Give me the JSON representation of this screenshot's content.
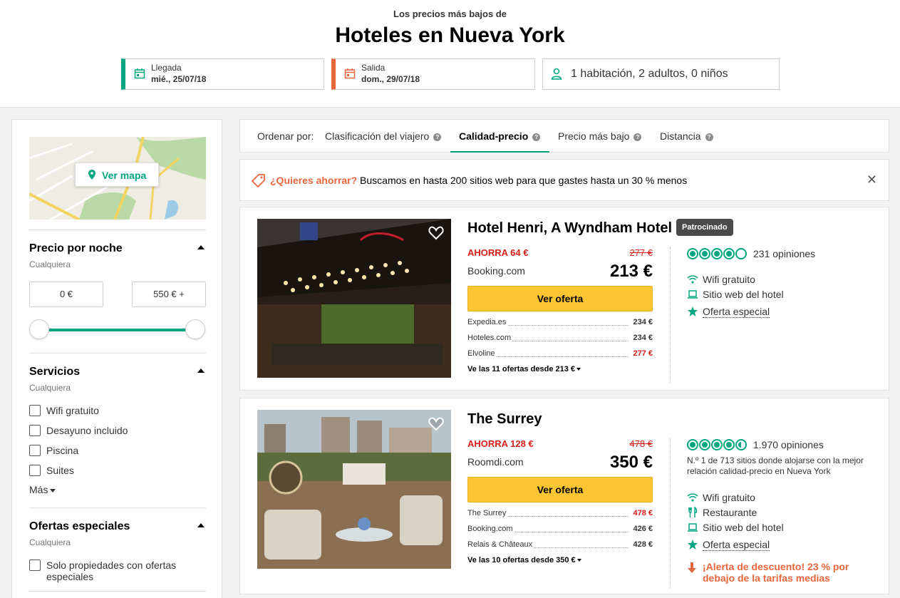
{
  "header": {
    "subtitle": "Los precios más bajos de",
    "title": "Hoteles en Nueva York",
    "checkin": {
      "label": "Llegada",
      "value": "mié., 25/07/18"
    },
    "checkout": {
      "label": "Salida",
      "value": "dom., 29/07/18"
    },
    "guests": "1 habitación, 2 adultos, 0 niños"
  },
  "sidebar": {
    "map_button": "Ver mapa",
    "price": {
      "title": "Precio por noche",
      "subtitle": "Cualquiera",
      "min": "0 €",
      "max": "550 € +",
      "range_selected": [
        0,
        1
      ]
    },
    "services": {
      "title": "Servicios",
      "subtitle": "Cualquiera",
      "items": [
        "Wifi gratuito",
        "Desayuno incluido",
        "Piscina",
        "Suites"
      ],
      "more": "Más"
    },
    "offers": {
      "title": "Ofertas especiales",
      "subtitle": "Cualquiera",
      "items": [
        "Solo propiedades con ofertas especiales"
      ]
    }
  },
  "sort": {
    "label": "Ordenar por:",
    "options": [
      "Clasificación del viajero",
      "Calidad-precio",
      "Precio más bajo",
      "Distancia"
    ],
    "active": "Calidad-precio"
  },
  "savings_banner": {
    "highlight": "¿Quieres ahorrar?",
    "text": "Buscamos en hasta 200 sitios web para que gastes hasta un 30 % menos"
  },
  "hotels": [
    {
      "name": "Hotel Henri, A Wyndham Hotel",
      "badge": "Patrocinado",
      "saving": "AHORRA 64 €",
      "original_price": "277 €",
      "provider": "Booking.com",
      "price": "213 €",
      "button": "Ver oferta",
      "offers": [
        {
          "name": "Expedia.es",
          "price": "234 €",
          "red": false
        },
        {
          "name": "Hoteles.com",
          "price": "234 €",
          "red": false
        },
        {
          "name": "Elvoline",
          "price": "277 €",
          "red": true
        }
      ],
      "see_all": "Ve las 11 ofertas desde 213 €",
      "rating": 4,
      "reviews": "231 opiniones",
      "amenities": [
        "Wifi gratuito",
        "Sitio web del hotel",
        "Oferta especial"
      ]
    },
    {
      "name": "The Surrey",
      "saving": "AHORRA 128 €",
      "original_price": "478 €",
      "provider": "Roomdi.com",
      "price": "350 €",
      "button": "Ver oferta",
      "offers": [
        {
          "name": "The Surrey",
          "price": "478 €",
          "red": true
        },
        {
          "name": "Booking.com",
          "price": "426 €",
          "red": false
        },
        {
          "name": "Relais & Châteaux",
          "price": "428 €",
          "red": false
        }
      ],
      "see_all": "Ve las 10 ofertas desde 350 €",
      "rating": 4.5,
      "reviews": "1.970 opiniones",
      "ranking": "N.º 1 de 713 sitios donde alojarse con la mejor relación calidad-precio en Nueva York",
      "amenities": [
        "Wifi gratuito",
        "Restaurante",
        "Sitio web del hotel",
        "Oferta especial"
      ],
      "alert": "¡Alerta de descuento! 23 % por debajo de la tarifas medias"
    }
  ],
  "colors": {
    "green": "#00a680",
    "orange": "#e8663d",
    "red": "#d91e18",
    "yellow": "#fcc531"
  }
}
